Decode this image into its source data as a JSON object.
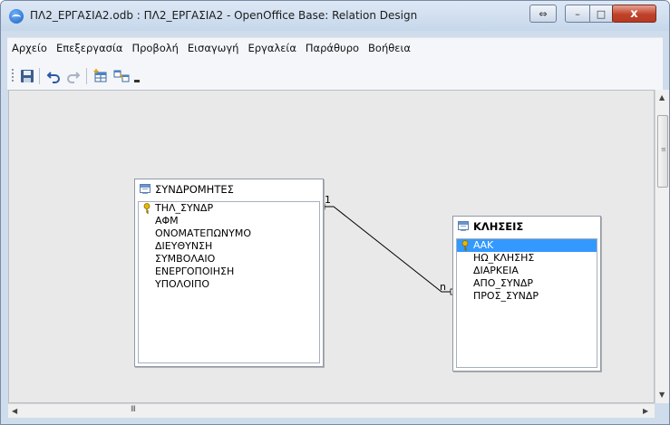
{
  "window": {
    "title": "ΠΛ2_ΕΡΓΑΣΙΑ2.odb : ΠΛ2_ΕΡΓΑΣΙΑ2 - OpenOffice Base: Relation Design",
    "controls": {
      "restore_swap": "⇔",
      "minimize": "–",
      "maximize": "□",
      "close": "x"
    }
  },
  "menu": [
    {
      "label": "Αρχείο"
    },
    {
      "label": "Επεξεργασία"
    },
    {
      "label": "Προβολή"
    },
    {
      "label": "Εισαγωγή"
    },
    {
      "label": "Εργαλεία"
    },
    {
      "label": "Παράθυρο"
    },
    {
      "label": "Βοήθεια"
    }
  ],
  "toolbar": {
    "buttons": [
      "save-icon",
      "undo-icon",
      "redo-icon",
      "add-table-icon",
      "new-relation-icon",
      "dropdown-arrow-icon"
    ]
  },
  "tables": {
    "subscribers": {
      "name": "ΣΥΝΔΡΟΜΗΤΕΣ",
      "fields": [
        {
          "name": "ΤΗΛ_ΣΥΝΔΡ",
          "primary_key": true
        },
        {
          "name": "ΑΦΜ",
          "primary_key": false
        },
        {
          "name": "ΟΝΟΜΑΤΕΠΩΝΥΜΟ",
          "primary_key": false
        },
        {
          "name": "ΔΙΕΥΘΥΝΣΗ",
          "primary_key": false
        },
        {
          "name": "ΣΥΜΒΟΛΑΙΟ",
          "primary_key": false
        },
        {
          "name": "ΕΝΕΡΓΟΠΟΙΗΣΗ",
          "primary_key": false
        },
        {
          "name": "ΥΠΟΛΟΙΠΟ",
          "primary_key": false
        }
      ]
    },
    "calls": {
      "name": "ΚΛΗΣΕΙΣ",
      "fields": [
        {
          "name": "ΑΑΚ",
          "primary_key": true,
          "selected": true
        },
        {
          "name": "ΗΩ_ΚΛΗΣΗΣ",
          "primary_key": false
        },
        {
          "name": "ΔΙΑΡΚΕΙΑ",
          "primary_key": false
        },
        {
          "name": "ΑΠΟ_ΣΥΝΔΡ",
          "primary_key": false
        },
        {
          "name": "ΠΡΟΣ_ΣΥΝΔΡ",
          "primary_key": false
        }
      ]
    }
  },
  "relation": {
    "from_cardinality": "1",
    "to_cardinality": "n",
    "line_color": "#000000"
  },
  "scrollbar": {
    "h_thumb_glyph": "III"
  },
  "colors": {
    "selection": "#3399ff",
    "workspace": "#e9e9e9",
    "close_button": "#c0412a"
  }
}
